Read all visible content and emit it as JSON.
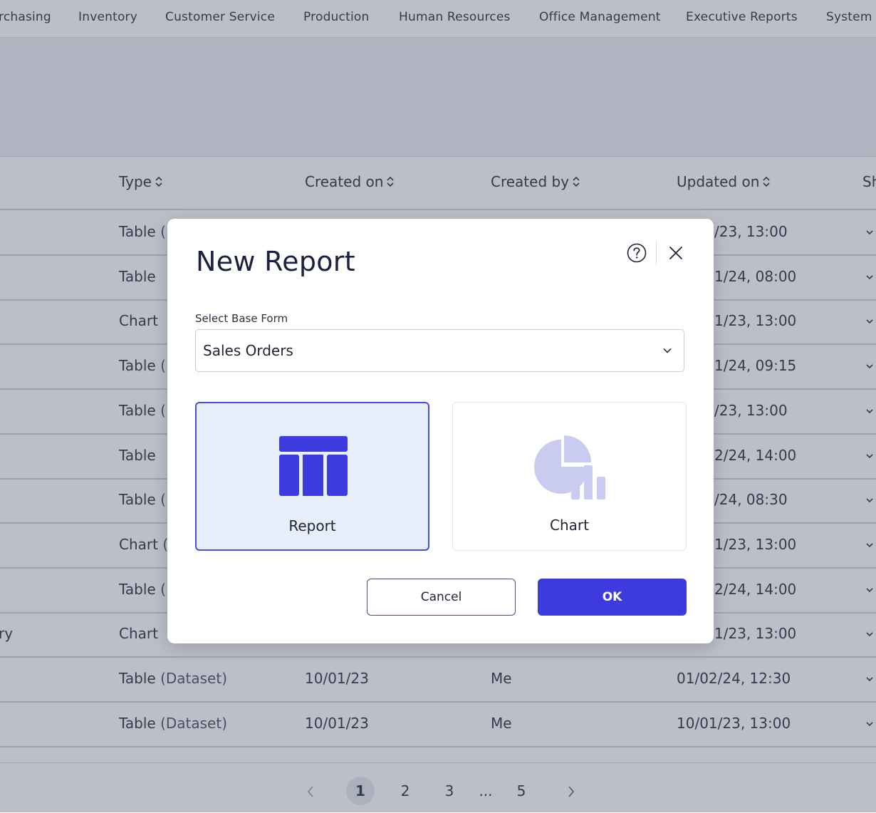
{
  "nav": {
    "items": [
      "rchasing",
      "Inventory",
      "Customer Service",
      "Production",
      "Human Resources",
      "Office Management",
      "Executive Reports",
      "System"
    ]
  },
  "table": {
    "headers": [
      "Type",
      "Created on",
      "Created by",
      "Updated on",
      "Sh"
    ],
    "rows": [
      {
        "lead": "",
        "type": "Table",
        "type_extra": "(",
        "created_on": "",
        "created_by": "",
        "updated_on": "/23, 13:00"
      },
      {
        "lead": "",
        "type": "Table",
        "type_extra": "",
        "created_on": "",
        "created_by": "",
        "updated_on": "1/24, 08:00"
      },
      {
        "lead": "",
        "type": "Chart",
        "type_extra": "",
        "created_on": "",
        "created_by": "",
        "updated_on": "1/23, 13:00"
      },
      {
        "lead": "",
        "type": "Table",
        "type_extra": "(",
        "created_on": "",
        "created_by": "",
        "updated_on": "1/24, 09:15"
      },
      {
        "lead": "",
        "type": "Table",
        "type_extra": "(",
        "created_on": "",
        "created_by": "",
        "updated_on": "/23, 13:00"
      },
      {
        "lead": "",
        "type": "Table",
        "type_extra": "",
        "created_on": "",
        "created_by": "",
        "updated_on": "2/24, 14:00"
      },
      {
        "lead": "",
        "type": "Table",
        "type_extra": "(",
        "created_on": "",
        "created_by": "",
        "updated_on": "/24, 08:30"
      },
      {
        "lead": "",
        "type": "Chart",
        "type_extra": "(",
        "created_on": "",
        "created_by": "",
        "updated_on": "1/23, 13:00"
      },
      {
        "lead": "",
        "type": "Table",
        "type_extra": "(",
        "created_on": "",
        "created_by": "",
        "updated_on": "2/24, 14:00"
      },
      {
        "lead": "ry",
        "type": "Chart",
        "type_extra": "",
        "created_on": "",
        "created_by": "",
        "updated_on": "1/23, 13:00"
      },
      {
        "lead": "",
        "type": "Table",
        "type_extra": "(Dataset)",
        "created_on": "10/01/23",
        "created_by": "Me",
        "updated_on": "01/02/24, 12:30"
      },
      {
        "lead": "",
        "type": "Table",
        "type_extra": "(Dataset)",
        "created_on": "10/01/23",
        "created_by": "Me",
        "updated_on": "10/01/23, 13:00"
      }
    ]
  },
  "pagination": {
    "pages": [
      "1",
      "2",
      "3",
      "...",
      "5"
    ],
    "current": "1"
  },
  "modal": {
    "title": "New Report",
    "field_label": "Select Base Form",
    "select_value": "Sales Orders",
    "options": [
      {
        "label": "Report",
        "icon": "table-icon",
        "selected": true
      },
      {
        "label": "Chart",
        "icon": "pie-chart-icon",
        "selected": false
      }
    ],
    "cancel_label": "Cancel",
    "ok_label": "OK",
    "colors": {
      "accent": "#3d3be0",
      "selected_bg": "#e6edfb",
      "chart_icon": "#c9cbf0"
    }
  }
}
